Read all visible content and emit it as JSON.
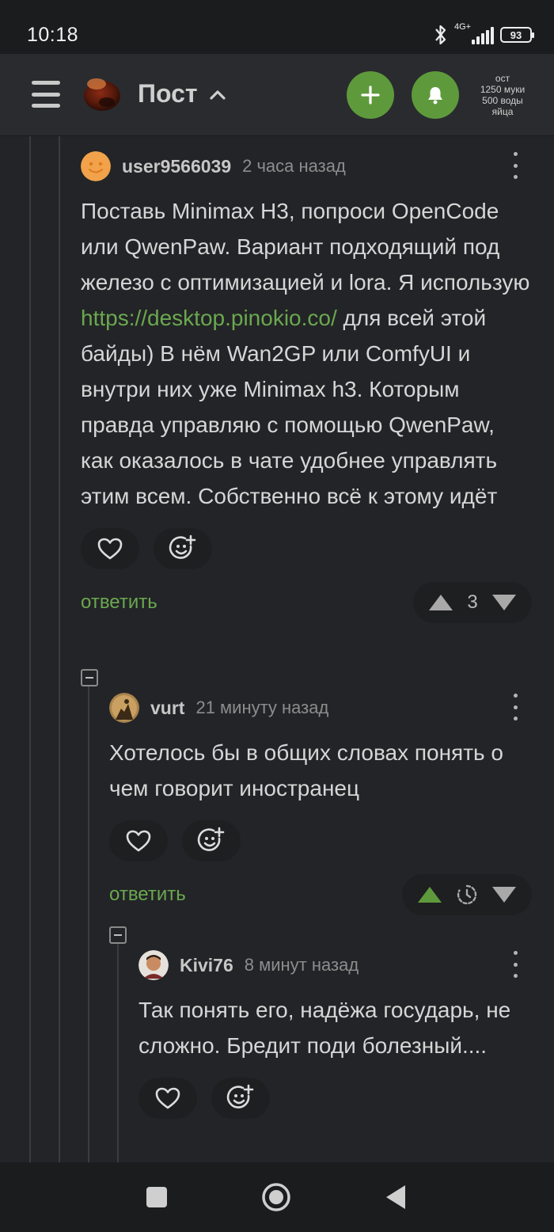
{
  "statusbar": {
    "time": "10:18",
    "network": "4G+",
    "battery": "93"
  },
  "header": {
    "title": "Пост",
    "promo_lines": [
      "ост",
      "1250 муки",
      "500 воды",
      "яйца"
    ]
  },
  "comments": [
    {
      "username": "user9566039",
      "time": "2 часа назад",
      "text_before_link": "Поставь Minimax H3, попроси OpenCode или QwenPaw. Вариант подходящий под железо с оптимизацией и lora. Я использую ",
      "link": "https://desktop.pinokio.co/",
      "text_after_link": " для всей этой байды) В нём Wan2GP или ComfyUI и внутри них уже Minimax h3. Которым правда управляю с помощью QwenPaw, как оказалось в чате удобнее управлять этим всем. Собственно всё к этому идёт",
      "reply_label": "ответить",
      "score": "3"
    },
    {
      "username": "vurt",
      "time": "21 минуту назад",
      "text": "Хотелось бы в общих словах понять о чем говорит иностранец",
      "reply_label": "ответить",
      "score": ""
    },
    {
      "username": "Kivi76",
      "time": "8 минут назад",
      "text": "Так понять его, надёжа государь, не сложно. Бредит поди болезный...."
    }
  ],
  "icons": {
    "menu": "hamburger-icon",
    "logo": "pikabu-logo",
    "add": "plus-icon",
    "notifications": "bell-icon",
    "like": "heart-icon",
    "reaction": "emoji-add-icon",
    "upvote": "triangle-up-icon",
    "downvote": "triangle-down-icon",
    "pending": "clock-icon",
    "more": "kebab-icon",
    "collapse": "minus-box-icon"
  },
  "colors": {
    "accent_green": "#5e9a3c",
    "link_green": "#6aa84f",
    "background": "#232427",
    "header": "#2a2b2e"
  }
}
